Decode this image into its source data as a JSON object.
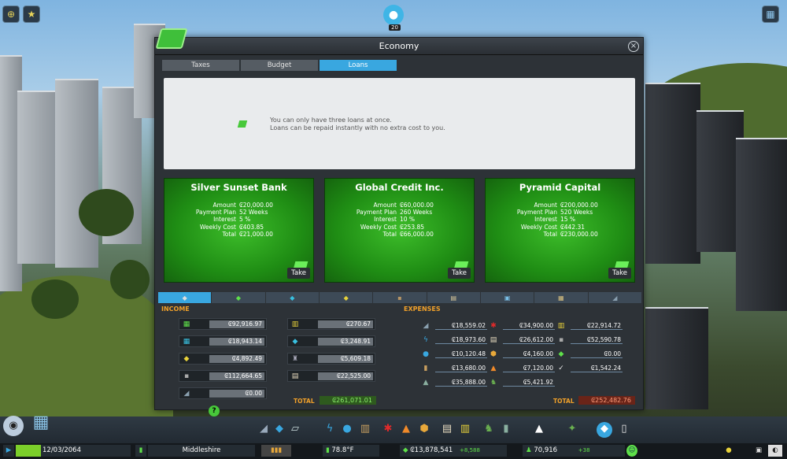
{
  "window": {
    "title": "Economy"
  },
  "tabs": [
    {
      "label": "Taxes"
    },
    {
      "label": "Budget"
    },
    {
      "label": "Loans",
      "active": true
    }
  ],
  "info": {
    "line1": "You can only have three loans at once.",
    "line2": "Loans can be repaid instantly with no extra cost to you."
  },
  "loan_labels": {
    "amount": "Amount",
    "payment_plan": "Payment Plan",
    "interest": "Interest",
    "weekly_cost": "Weekly Cost",
    "total": "Total",
    "take": "Take"
  },
  "banks": [
    {
      "name": "Silver Sunset Bank",
      "amount": "₢20,000.00",
      "payment_plan": "52 Weeks",
      "interest": "5 %",
      "weekly_cost": "₢403.85",
      "total": "₢21,000.00"
    },
    {
      "name": "Global Credit Inc.",
      "amount": "₢60,000.00",
      "payment_plan": "260 Weeks",
      "interest": "10 %",
      "weekly_cost": "₢253.85",
      "total": "₢66,000.00"
    },
    {
      "name": "Pyramid Capital",
      "amount": "₢200,000.00",
      "payment_plan": "520 Weeks",
      "interest": "15 %",
      "weekly_cost": "₢442.31",
      "total": "₢230,000.00"
    }
  ],
  "income": {
    "label": "INCOME",
    "items": [
      {
        "icon": "residential-icon",
        "value": "₢92,916.97"
      },
      {
        "icon": "commercial-icon",
        "value": "₢18,943.14"
      },
      {
        "icon": "industrial-icon",
        "value": "₢4,892.49"
      },
      {
        "icon": "office-icon",
        "value": "₢112,664.65"
      },
      {
        "icon": "road-icon",
        "value": "₢0.00"
      },
      {
        "icon": "specialized-industry-icon",
        "value": "₢270.67"
      },
      {
        "icon": "tourism-icon",
        "value": "₢3,248.91"
      },
      {
        "icon": "public-transport-icon",
        "value": "₢5,609.18"
      },
      {
        "icon": "policies-icon",
        "value": "₢22,525.00"
      }
    ],
    "total_label": "TOTAL",
    "total": "₢261,071.01"
  },
  "expenses": {
    "label": "EXPENSES",
    "items": [
      {
        "icon": "roads-icon",
        "value": "₢18,559.02"
      },
      {
        "icon": "electricity-icon",
        "value": "₢18,973.60"
      },
      {
        "icon": "water-icon",
        "value": "₢10,120.48"
      },
      {
        "icon": "garbage-icon",
        "value": "₢13,680.00"
      },
      {
        "icon": "landscaping-icon",
        "value": "₢35,888.00"
      },
      {
        "icon": "healthcare-icon",
        "value": "₢34,900.00"
      },
      {
        "icon": "education-icon",
        "value": "₢26,612.00"
      },
      {
        "icon": "police-icon",
        "value": "₢4,160.00"
      },
      {
        "icon": "fire-icon",
        "value": "₢7,120.00"
      },
      {
        "icon": "monument-icon",
        "value": "₢5,421.92"
      },
      {
        "icon": "transport-icon",
        "value": "₢22,914.72"
      },
      {
        "icon": "industry-icon",
        "value": "₢52,590.78"
      },
      {
        "icon": "loan-icon",
        "value": "₢0.00"
      },
      {
        "icon": "policy-icon",
        "value": "₢1,542.24"
      }
    ],
    "total_label": "TOTAL",
    "total": "₢252,482.76"
  },
  "chirper_count": "20",
  "status": {
    "date": "12/03/2064",
    "city": "Middleshire",
    "temperature": "78.8°F",
    "money": "₢13,878,541",
    "income_delta": "+8,588",
    "population": "70,916",
    "pop_delta": "+38"
  },
  "colors": {
    "accent": "#39a7e0",
    "bank_green": "#2aa81c",
    "section_orange": "#f0a02a"
  }
}
